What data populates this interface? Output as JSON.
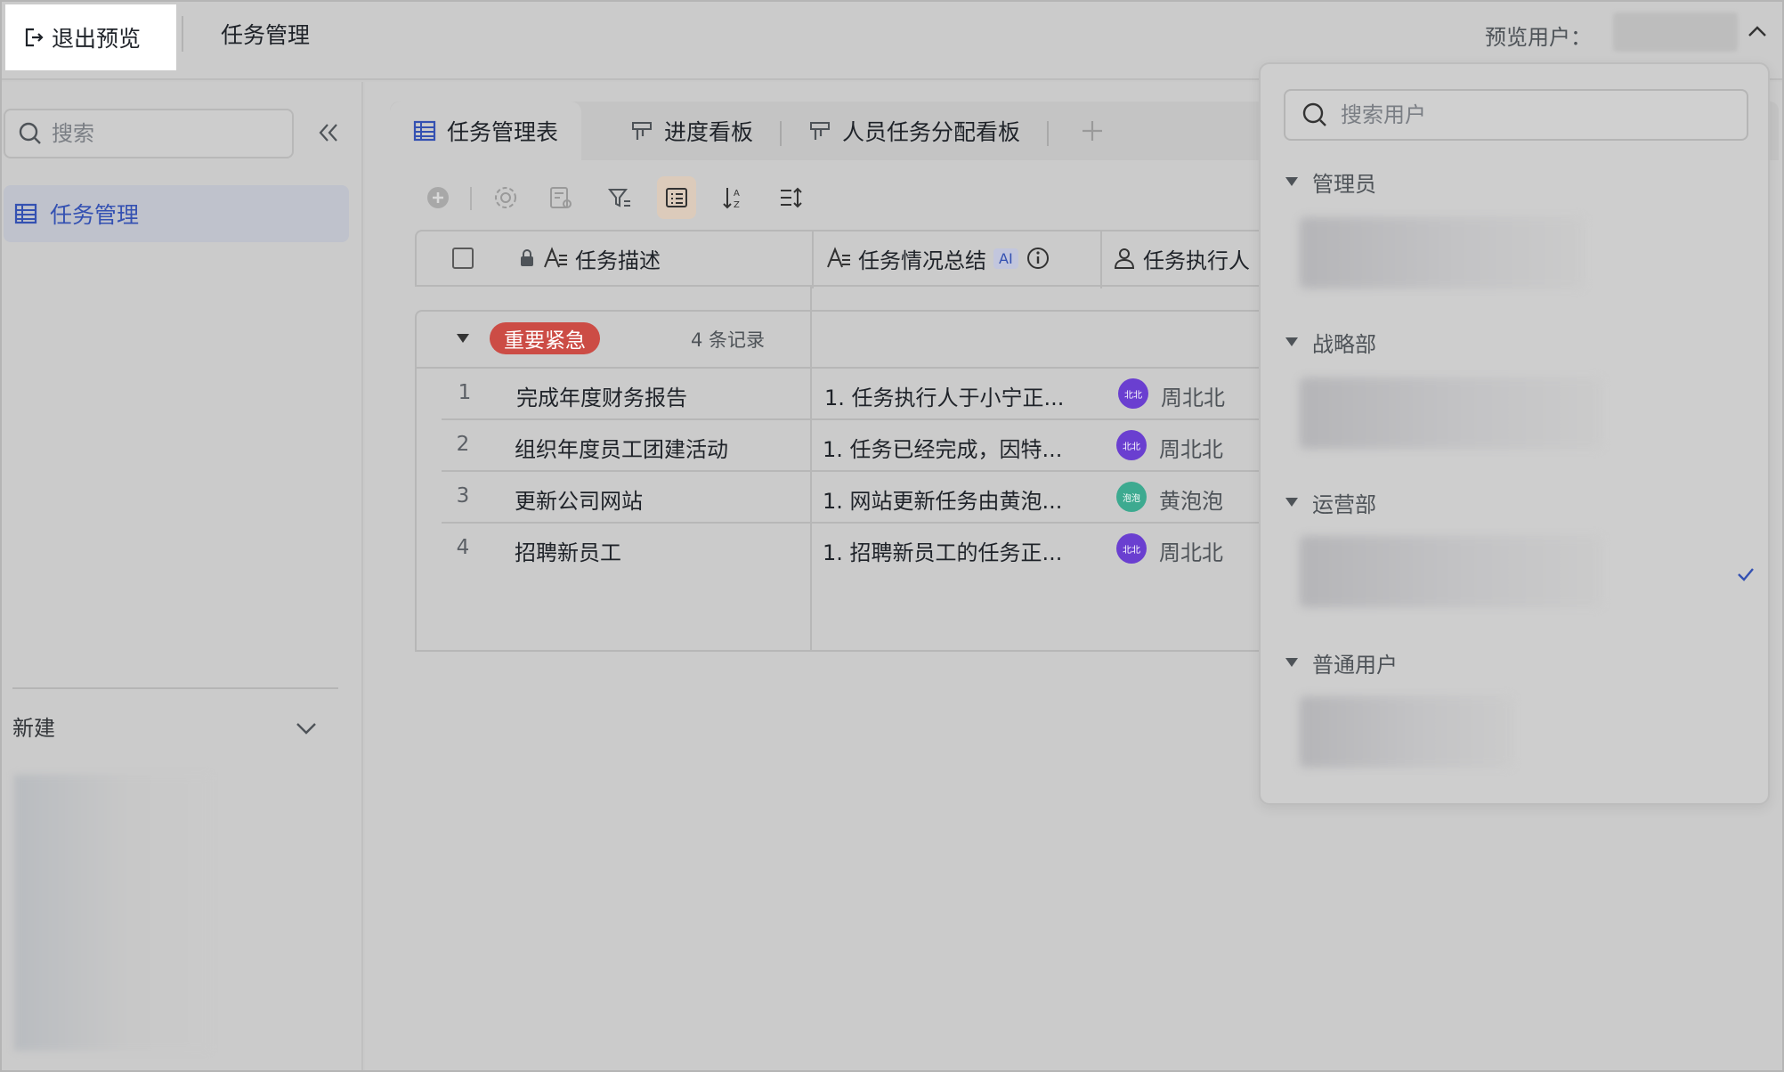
{
  "topbar": {
    "exit_label": "退出预览",
    "app_title": "任务管理",
    "preview_user_label": "预览用户："
  },
  "sidebar": {
    "search_placeholder": "搜索",
    "items": [
      {
        "label": "任务管理",
        "icon": "table-icon"
      }
    ],
    "new_label": "新建"
  },
  "tabs": [
    {
      "label": "任务管理表",
      "icon": "table-icon",
      "active": true
    },
    {
      "label": "进度看板",
      "icon": "kanban-icon",
      "active": false
    },
    {
      "label": "人员任务分配看板",
      "icon": "kanban-icon",
      "active": false
    }
  ],
  "toolbar": [
    "add-icon",
    "settings-icon",
    "form-settings-icon",
    "filter-icon",
    "group-icon",
    "sort-icon",
    "row-height-icon"
  ],
  "table": {
    "columns": [
      {
        "label": "任务描述",
        "icon": "text-icon",
        "locked": true
      },
      {
        "label": "任务情况总结",
        "icon": "text-icon",
        "badge": "AI"
      },
      {
        "label": "任务执行人",
        "icon": "person-icon"
      }
    ],
    "group": {
      "tag": "重要紧急",
      "count": "4 条记录",
      "color": "#cc4c45"
    },
    "rows": [
      {
        "num": "1",
        "desc": "完成年度财务报告",
        "summary": "1. 任务执行人于小宁正...",
        "avatar": "北北",
        "avatar_color": "#6a3fd0",
        "person": "周北北"
      },
      {
        "num": "2",
        "desc": "组织年度员工团建活动",
        "summary": "1. 任务已经完成，因特...",
        "avatar": "北北",
        "avatar_color": "#6a3fd0",
        "person": "周北北"
      },
      {
        "num": "3",
        "desc": "更新公司网站",
        "summary": "1. 网站更新任务由黄泡...",
        "avatar": "泡泡",
        "avatar_color": "#3daa90",
        "person": "黄泡泡"
      },
      {
        "num": "4",
        "desc": "招聘新员工",
        "summary": "1. 招聘新员工的任务正...",
        "avatar": "北北",
        "avatar_color": "#6a3fd0",
        "person": "周北北"
      }
    ]
  },
  "dropdown": {
    "search_placeholder": "搜索用户",
    "groups": [
      {
        "label": "管理员"
      },
      {
        "label": "战略部"
      },
      {
        "label": "运营部",
        "selected": true
      },
      {
        "label": "普通用户"
      }
    ]
  },
  "colors": {
    "accent": "#3451b2",
    "check": "#3451b2"
  }
}
